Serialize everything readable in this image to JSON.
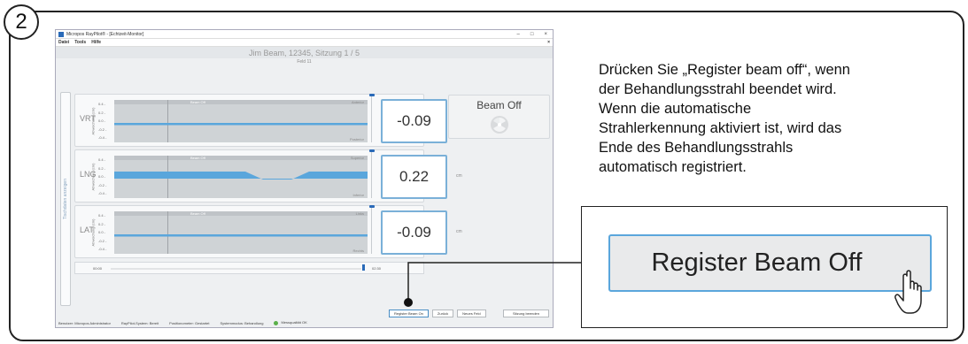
{
  "step_badge": "2",
  "app": {
    "window_title": "Micropos RayPilot® - [Echtzeit-Monitor]",
    "window_controls": [
      "–",
      "□",
      "×"
    ],
    "menu": [
      "Datei",
      "Tools",
      "Hilfe"
    ],
    "menu_close": "×",
    "patient_header": "Jim Beam, 12345, Sitzung 1 / 5",
    "field_label": "Feld 11",
    "side_tab": "Tischdaten anzeigen",
    "y_axis_label": "Abweichung (cm)",
    "ticks": [
      "0.4 -",
      "0.2 -",
      "0.0 -",
      "-0.2 -",
      "-0.4 -"
    ],
    "unit": "cm",
    "axes": [
      {
        "name": "VRT",
        "value": "-0.09",
        "beam_tag": "Beam Off",
        "top_label": "Anterior",
        "bottom_label": "Posterior"
      },
      {
        "name": "LNG",
        "value": "0.22",
        "beam_tag": "Beam Off",
        "top_label": "Superior",
        "bottom_label": "Inferior"
      },
      {
        "name": "LAT",
        "value": "-0.09",
        "beam_tag": "Beam Off",
        "top_label": "Links",
        "bottom_label": "Rechts"
      }
    ],
    "beam_status": "Beam Off",
    "timeline": {
      "start": "00:00",
      "end": "02:30"
    },
    "buttons": {
      "register_beam_on": "Register Beam On",
      "back": "Zurück",
      "new_field": "Neues Feld",
      "end_session": "Sitzung beenden"
    },
    "status": {
      "user": "Benutzer: Micropos Administrator",
      "system": "RayPilot-System: Bereit",
      "positionometer": "Positionometer: Gestartet",
      "mode": "Systemmodus: Behandlung",
      "quality": "Messqualität OK"
    }
  },
  "instruction": {
    "line1": " Drücken Sie „Register beam off“, wenn",
    "line2": "der Behandlungsstrahl beendet wird.",
    "line3": " Wenn die automatische",
    "line4": "Strahlerkennung aktiviert ist, wird das",
    "line5": "Ende des Behandlungsstrahls",
    "line6": "automatisch registriert."
  },
  "callout_button": "Register Beam Off",
  "colors": {
    "accent": "#5aa6dc",
    "series": "#5aa6dc",
    "ok": "#5ab04a"
  }
}
